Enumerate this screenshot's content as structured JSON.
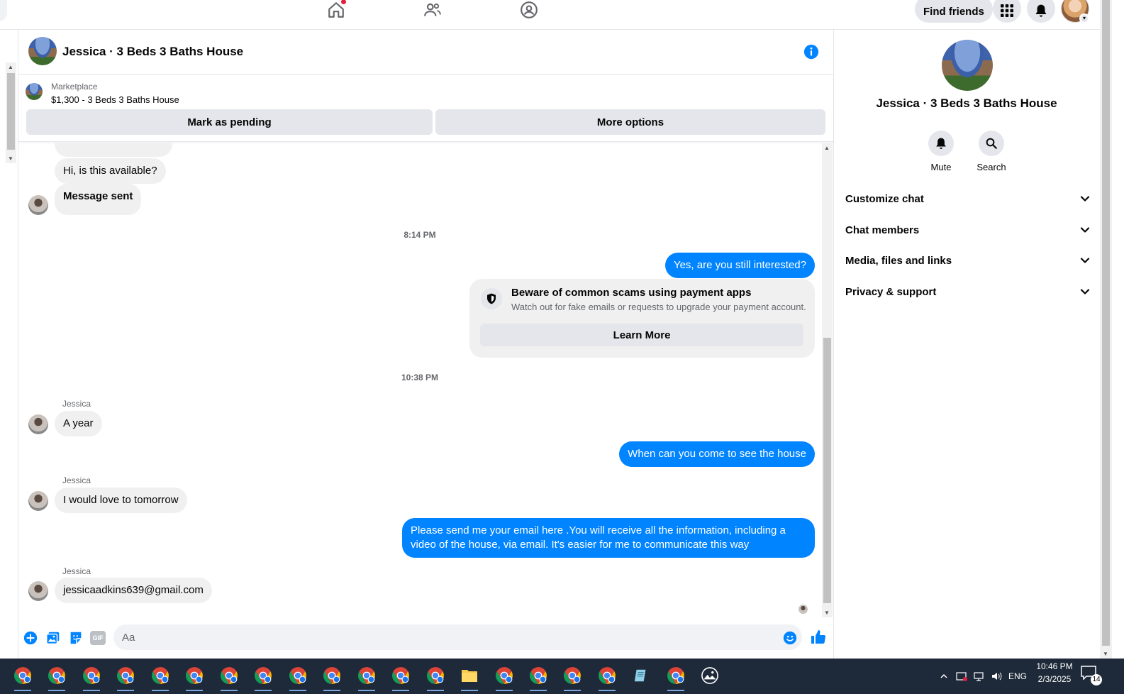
{
  "topnav": {
    "find_friends_label": "Find friends",
    "icons": [
      "home-icon",
      "friends-icon",
      "groups-icon",
      "apps-grid-icon",
      "notifications-icon"
    ]
  },
  "chat": {
    "title": "Jessica · 3 Beds 3 Baths House",
    "marketplace": {
      "label": "Marketplace",
      "item": "$1,300 - 3 Beds 3 Baths House",
      "mark_pending_label": "Mark as pending",
      "more_options_label": "More options"
    },
    "messages": {
      "m1": "Hi, is this available?",
      "m2": "Message sent",
      "ts1": "8:14 PM",
      "m3": "Yes, are you still interested?",
      "scam_title": "Beware of common scams using payment apps",
      "scam_sub": "Watch out for fake emails or requests to upgrade your payment account.",
      "learn_more": "Learn More",
      "ts2": "10:38 PM",
      "sender1": "Jessica",
      "m4": "A year",
      "m5": "When can you come to see the house",
      "sender2": "Jessica",
      "m6": "I would love to tomorrow",
      "m7": "Please send me your email here .You will receive all the information, including a video of the house, via email. It's easier for me to communicate this way",
      "sender3": "Jessica",
      "m8": "jessicaadkins639@gmail.com"
    },
    "composer": {
      "placeholder": "Aa",
      "gif_label": "GIF"
    }
  },
  "info_panel": {
    "name": "Jessica · 3 Beds 3 Baths House",
    "mute_label": "Mute",
    "search_label": "Search",
    "sections": [
      "Customize chat",
      "Chat members",
      "Media, files and links",
      "Privacy & support"
    ]
  },
  "taskbar": {
    "lang": "ENG",
    "time": "10:46 PM",
    "date": "2/3/2025",
    "notifications": "14"
  },
  "colors": {
    "accent": "#0084ff",
    "badge": "#e41e3f",
    "bubble_in": "#f0f0f0",
    "button_gray": "#e4e6eb"
  }
}
